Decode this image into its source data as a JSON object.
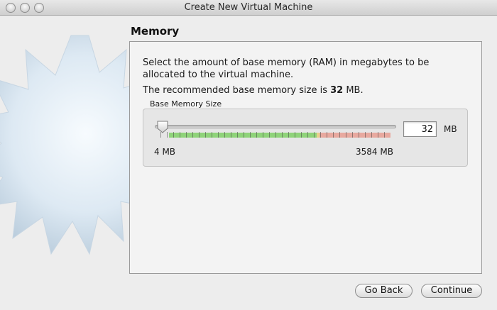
{
  "window": {
    "title": "Create New Virtual Machine"
  },
  "page": {
    "heading": "Memory",
    "description": "Select the amount of base memory (RAM) in megabytes to be allocated to the virtual machine.",
    "recommended_prefix": "The recommended base memory size is ",
    "recommended_value": "32",
    "recommended_suffix": " MB."
  },
  "memory": {
    "group_label": "Base Memory Size",
    "value": "32",
    "unit": "MB",
    "min_label": "4 MB",
    "max_label": "3584 MB"
  },
  "buttons": {
    "back": "Go Back",
    "continue": "Continue"
  },
  "colors": {
    "scale_green": "#8fd37a",
    "scale_yellow": "#e6d28a",
    "scale_red": "#e8a99f"
  },
  "icons": [
    "window-close-icon",
    "window-minimize-icon",
    "window-zoom-icon",
    "starburst-decoration-icon",
    "slider-thumb-icon"
  ]
}
